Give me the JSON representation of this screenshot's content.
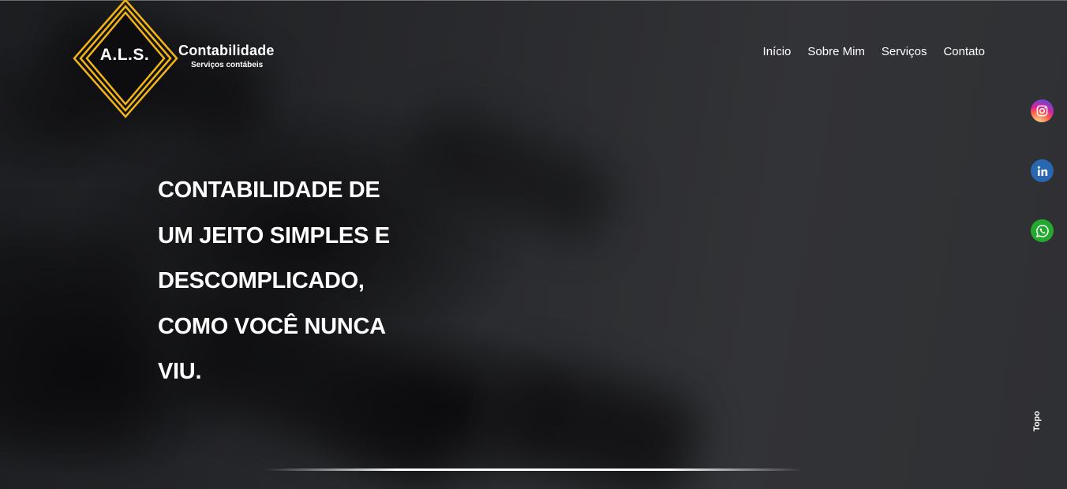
{
  "brand": {
    "mark": "A.L.S.",
    "name": "Contabilidade",
    "tagline": "Serviços contábeis",
    "accent_color": "#f2b417"
  },
  "nav": {
    "items": [
      {
        "label": "Início"
      },
      {
        "label": "Sobre Mim"
      },
      {
        "label": "Serviços"
      },
      {
        "label": "Contato"
      }
    ]
  },
  "social": {
    "items": [
      {
        "icon": "instagram-icon",
        "color": "#d6249f"
      },
      {
        "icon": "linkedin-icon",
        "color": "#2867b2"
      },
      {
        "icon": "whatsapp-icon",
        "color": "#25a82f"
      }
    ]
  },
  "hero": {
    "lines": [
      "CONTABILIDADE DE",
      "UM JEITO SIMPLES E",
      "DESCOMPLICADO,",
      "COMO VOCÊ NUNCA",
      "VIU."
    ]
  },
  "topo_label": "Topo"
}
